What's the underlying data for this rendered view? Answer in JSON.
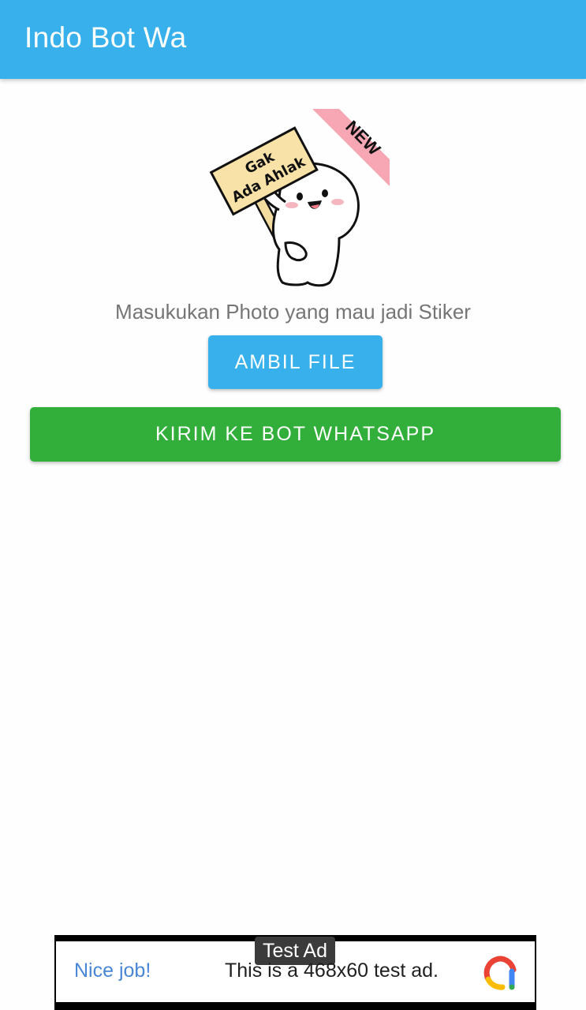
{
  "appbar": {
    "title": "Indo Bot Wa",
    "color": "#38b0ec"
  },
  "sticker": {
    "sign_line1": "Gak",
    "sign_line2": "Ada Ahlak",
    "ribbon": "NEW",
    "icon": "sticker-character-image"
  },
  "main": {
    "subtitle": "Masukukan Photo yang mau jadi Stiker",
    "pick_button_label": "AMBIL FILE",
    "pick_button_color": "#38b0ec",
    "send_button_label": "KIRIM KE BOT WHATSAPP",
    "send_button_color": "#32af3a"
  },
  "ad": {
    "badge": "Test Ad",
    "headline": "Nice job!",
    "body": "This is a 468x60 test ad.",
    "icon": "admob-logo-icon"
  }
}
